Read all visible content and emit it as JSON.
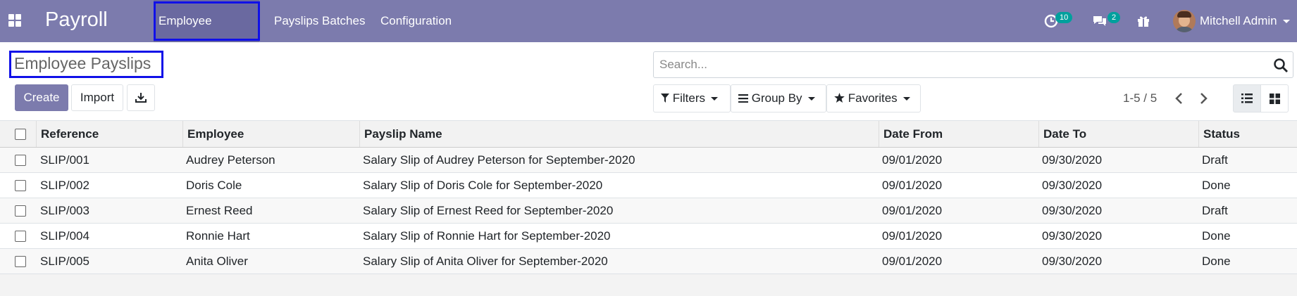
{
  "navbar": {
    "brand": "Payroll",
    "menu": [
      "Employee Payslips",
      "Payslips Batches",
      "Configuration"
    ],
    "activity_count": "10",
    "message_count": "2",
    "user_name": "Mitchell Admin"
  },
  "control_panel": {
    "breadcrumb": "Employee Payslips",
    "create_label": "Create",
    "import_label": "Import",
    "search_placeholder": "Search...",
    "filters_label": "Filters",
    "groupby_label": "Group By",
    "favorites_label": "Favorites",
    "pager": "1-5 / 5"
  },
  "table": {
    "columns": [
      "Reference",
      "Employee",
      "Payslip Name",
      "Date From",
      "Date To",
      "Status"
    ],
    "rows": [
      [
        "SLIP/001",
        "Audrey Peterson",
        "Salary Slip of Audrey Peterson for September-2020",
        "09/01/2020",
        "09/30/2020",
        "Draft"
      ],
      [
        "SLIP/002",
        "Doris Cole",
        "Salary Slip of Doris Cole for September-2020",
        "09/01/2020",
        "09/30/2020",
        "Done"
      ],
      [
        "SLIP/003",
        "Ernest Reed",
        "Salary Slip of Ernest Reed for September-2020",
        "09/01/2020",
        "09/30/2020",
        "Draft"
      ],
      [
        "SLIP/004",
        "Ronnie Hart",
        "Salary Slip of Ronnie Hart for September-2020",
        "09/01/2020",
        "09/30/2020",
        "Done"
      ],
      [
        "SLIP/005",
        "Anita Oliver",
        "Salary Slip of Anita Oliver for September-2020",
        "09/01/2020",
        "09/30/2020",
        "Done"
      ]
    ]
  },
  "colors": {
    "navbar": "#7c7bad",
    "highlight_box": "#1010e8",
    "badge": "#00a09d"
  }
}
